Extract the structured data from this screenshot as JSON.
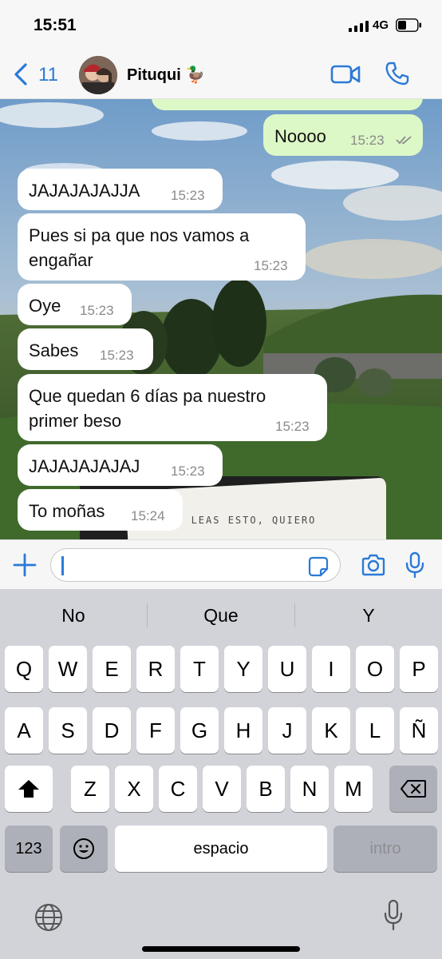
{
  "status": {
    "time": "15:51",
    "network": "4G"
  },
  "header": {
    "back_count": "11",
    "contact_name": "Pituqui 🦆"
  },
  "messages": [
    {
      "dir": "out",
      "text": "Noooo",
      "time": "15:23"
    },
    {
      "dir": "in",
      "text": "JAJAJAJAJJA",
      "time": "15:23"
    },
    {
      "dir": "in",
      "text_lines": [
        "Pues si pa que nos vamos a",
        "engañar"
      ],
      "time": "15:23"
    },
    {
      "dir": "in",
      "text": "Oye",
      "time": "15:23"
    },
    {
      "dir": "in",
      "text": "Sabes",
      "time": "15:23"
    },
    {
      "dir": "in",
      "text_lines": [
        "Que quedan 6 días pa nuestro",
        "primer beso"
      ],
      "time": "15:23"
    },
    {
      "dir": "in",
      "text": "JAJAJAJAJAJ",
      "time": "15:23"
    },
    {
      "dir": "in",
      "text": "To moñas",
      "time": "15:24"
    }
  ],
  "photo": {
    "handwriting": "CUANDO LEAS ESTO, QUIERO"
  },
  "input": {
    "value": ""
  },
  "keyboard": {
    "suggestions": [
      "No",
      "Que",
      "Y"
    ],
    "row1": [
      "Q",
      "W",
      "E",
      "R",
      "T",
      "Y",
      "U",
      "I",
      "O",
      "P"
    ],
    "row2": [
      "A",
      "S",
      "D",
      "F",
      "G",
      "H",
      "J",
      "K",
      "L",
      "Ñ"
    ],
    "row3": [
      "Z",
      "X",
      "C",
      "V",
      "B",
      "N",
      "M"
    ],
    "numbers_label": "123",
    "space_label": "espacio",
    "return_label": "intro"
  },
  "colors": {
    "accent": "#2a7ad8",
    "outgoing_bubble": "#dcf8c6",
    "incoming_bubble": "#ffffff",
    "keyboard_bg": "#d1d3d9"
  },
  "icons": [
    "back-chevron-icon",
    "video-call-icon",
    "phone-icon",
    "plus-icon",
    "sticker-icon",
    "camera-icon",
    "microphone-icon",
    "shift-icon",
    "delete-icon",
    "emoji-icon",
    "globe-icon",
    "dictation-icon",
    "double-check-icon"
  ]
}
